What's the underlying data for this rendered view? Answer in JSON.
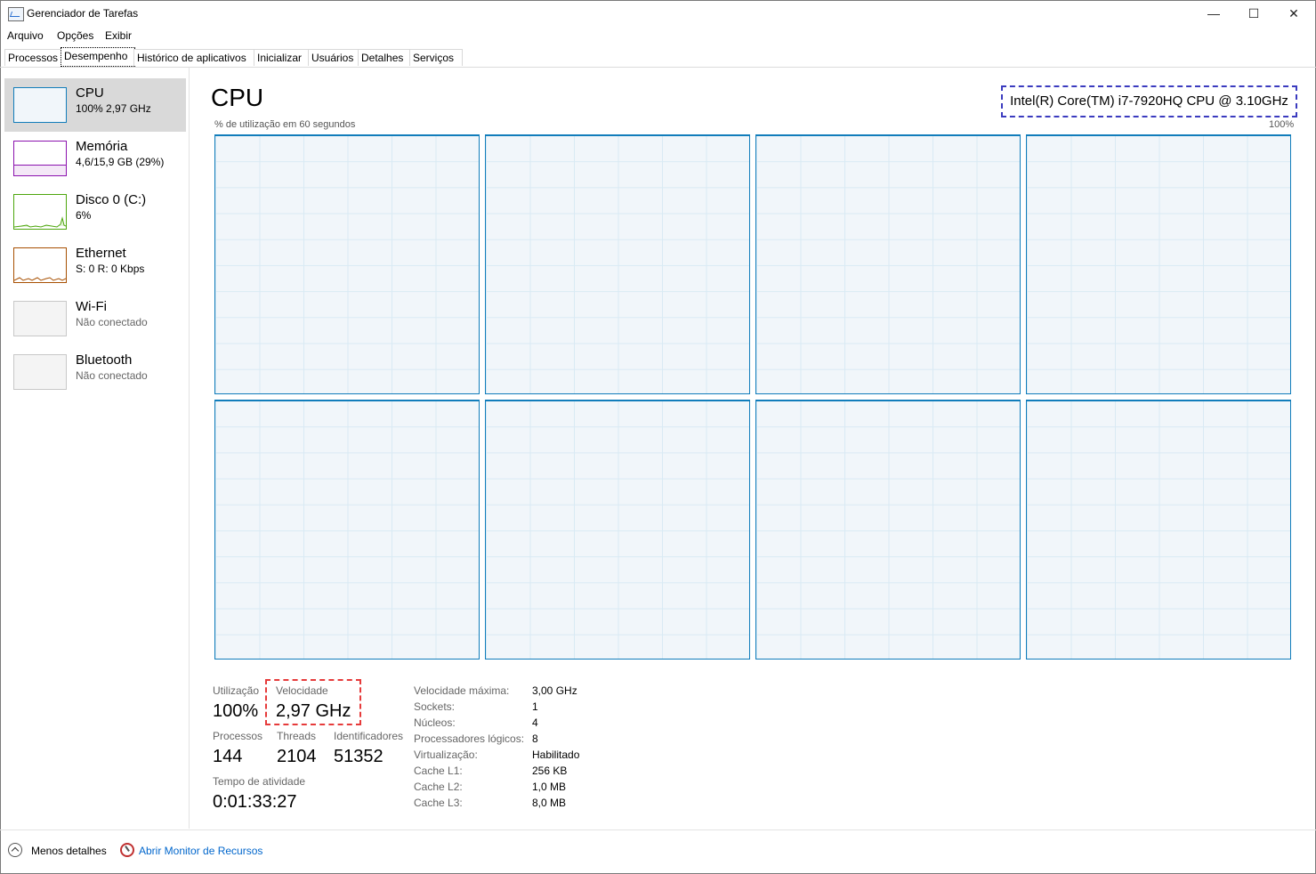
{
  "window": {
    "title": "Gerenciador de Tarefas"
  },
  "menu": [
    "Arquivo",
    "Opções",
    "Exibir"
  ],
  "tabs": [
    "Processos",
    "Desempenho",
    "Histórico de aplicativos",
    "Inicializar",
    "Usuários",
    "Detalhes",
    "Serviços"
  ],
  "active_tab": "Desempenho",
  "sidebar": {
    "items": [
      {
        "name": "CPU",
        "sub": "100%  2,97 GHz",
        "accent": "#117dbb"
      },
      {
        "name": "Memória",
        "sub": "4,6/15,9 GB (29%)",
        "accent": "#8b12ae"
      },
      {
        "name": "Disco 0 (C:)",
        "sub": "6%",
        "accent": "#4da60c"
      },
      {
        "name": "Ethernet",
        "sub": "S: 0  R: 0 Kbps",
        "accent": "#a74f01"
      },
      {
        "name": "Wi-Fi",
        "sub": "Não conectado",
        "accent": "#999999"
      },
      {
        "name": "Bluetooth",
        "sub": "Não conectado",
        "accent": "#999999"
      }
    ]
  },
  "main": {
    "title": "CPU",
    "model": "Intel(R) Core(TM) i7-7920HQ CPU @ 3.10GHz",
    "graph_label": "% de utilização em 60 segundos",
    "graph_max": "100%",
    "logical_processors": 8,
    "stats": {
      "utilization_label": "Utilização",
      "utilization": "100%",
      "speed_label": "Velocidade",
      "speed": "2,97 GHz",
      "processes_label": "Processos",
      "processes": "144",
      "threads_label": "Threads",
      "threads": "2104",
      "handles_label": "Identificadores",
      "handles": "51352",
      "uptime_label": "Tempo de atividade",
      "uptime": "0:01:33:27"
    },
    "details": [
      {
        "key": "Velocidade máxima:",
        "value": "3,00 GHz"
      },
      {
        "key": "Sockets:",
        "value": "1"
      },
      {
        "key": "Núcleos:",
        "value": "4"
      },
      {
        "key": "Processadores lógicos:",
        "value": "8"
      },
      {
        "key": "Virtualização:",
        "value": "Habilitado"
      },
      {
        "key": "Cache L1:",
        "value": "256 KB"
      },
      {
        "key": "Cache L2:",
        "value": "1,0 MB"
      },
      {
        "key": "Cache L3:",
        "value": "8,0 MB"
      }
    ]
  },
  "footer": {
    "less_details": "Menos detalhes",
    "resource_monitor": "Abrir Monitor de Recursos"
  }
}
